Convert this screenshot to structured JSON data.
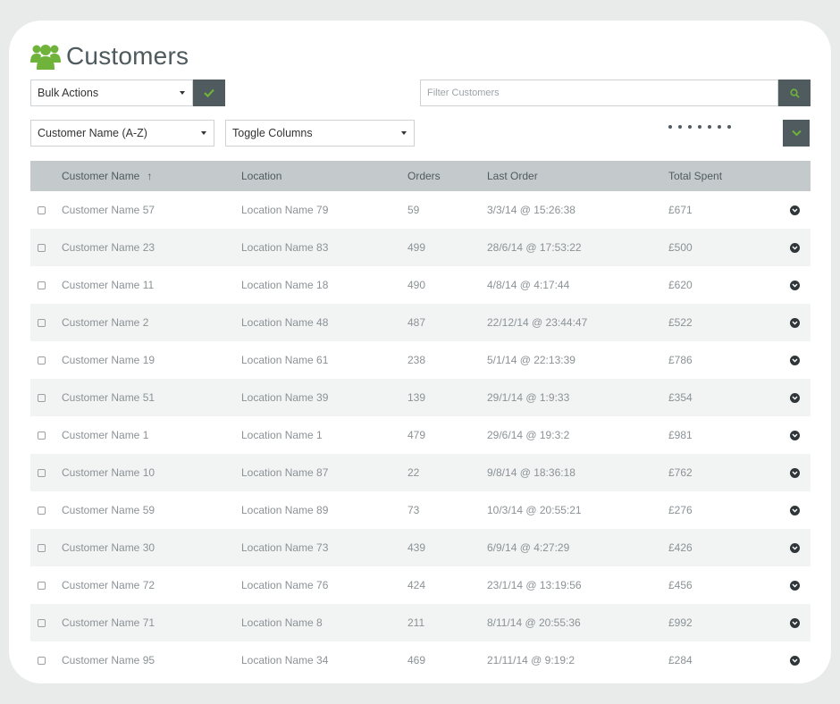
{
  "page": {
    "title": "Customers",
    "icon": "users-icon"
  },
  "bulk_actions": {
    "label": "Bulk Actions",
    "apply_icon": "check-icon"
  },
  "filter": {
    "placeholder": "Filter Customers",
    "value": "",
    "search_icon": "search-icon"
  },
  "sort_select": {
    "label": "Customer Name (A-Z)"
  },
  "toggle_columns": {
    "label": "Toggle Columns"
  },
  "more_button": {
    "icon": "chevron-down-icon"
  },
  "table": {
    "columns": [
      "Customer Name",
      "Location",
      "Orders",
      "Last Order",
      "Total Spent"
    ],
    "sort_indicator": "↑",
    "rows": [
      {
        "name": "Customer Name 57",
        "location": "Location Name 79",
        "orders": "59",
        "last_order": "3/3/14 @ 15:26:38",
        "total": "£671"
      },
      {
        "name": "Customer Name 23",
        "location": "Location Name 83",
        "orders": "499",
        "last_order": "28/6/14 @ 17:53:22",
        "total": "£500"
      },
      {
        "name": "Customer Name 11",
        "location": "Location Name 18",
        "orders": "490",
        "last_order": "4/8/14 @ 4:17:44",
        "total": "£620"
      },
      {
        "name": "Customer Name 2",
        "location": "Location Name 48",
        "orders": "487",
        "last_order": "22/12/14 @ 23:44:47",
        "total": "£522"
      },
      {
        "name": "Customer Name 19",
        "location": "Location Name 61",
        "orders": "238",
        "last_order": "5/1/14 @ 22:13:39",
        "total": "£786"
      },
      {
        "name": "Customer Name 51",
        "location": "Location Name 39",
        "orders": "139",
        "last_order": "29/1/14 @ 1:9:33",
        "total": "£354"
      },
      {
        "name": "Customer Name 1",
        "location": "Location Name 1",
        "orders": "479",
        "last_order": "29/6/14 @ 19:3:2",
        "total": "£981"
      },
      {
        "name": "Customer Name 10",
        "location": "Location Name 87",
        "orders": "22",
        "last_order": "9/8/14 @ 18:36:18",
        "total": "£762"
      },
      {
        "name": "Customer Name 59",
        "location": "Location Name 89",
        "orders": "73",
        "last_order": "10/3/14 @ 20:55:21",
        "total": "£276"
      },
      {
        "name": "Customer Name 30",
        "location": "Location Name 73",
        "orders": "439",
        "last_order": "6/9/14 @ 4:27:29",
        "total": "£426"
      },
      {
        "name": "Customer Name 72",
        "location": "Location Name 76",
        "orders": "424",
        "last_order": "23/1/14 @ 13:19:56",
        "total": "£456"
      },
      {
        "name": "Customer Name 71",
        "location": "Location Name 8",
        "orders": "211",
        "last_order": "8/11/14 @ 20:55:36",
        "total": "£992"
      },
      {
        "name": "Customer Name 95",
        "location": "Location Name 34",
        "orders": "469",
        "last_order": "21/11/14 @ 9:19:2",
        "total": "£284"
      }
    ]
  },
  "colors": {
    "accent": "#6fb33a",
    "dark_button": "#4f5b5e",
    "header_bg": "#c4cacc",
    "stripe": "#f2f4f4"
  }
}
